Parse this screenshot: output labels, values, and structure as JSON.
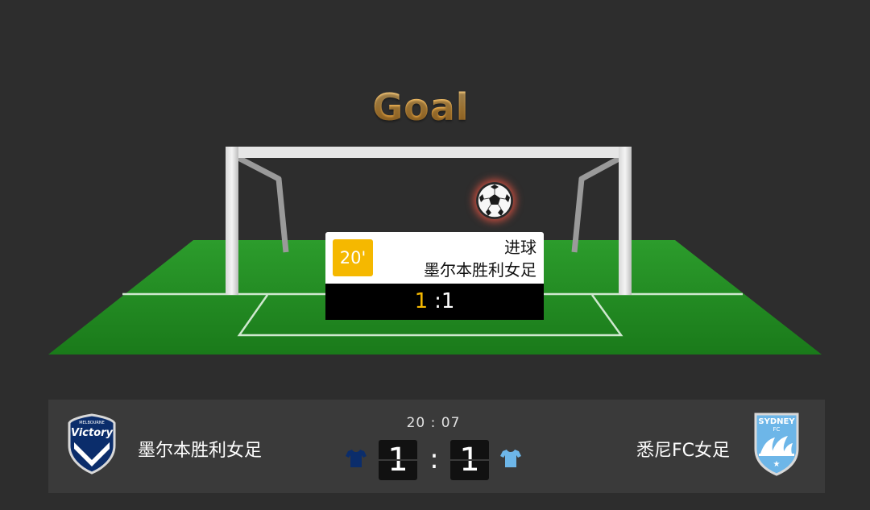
{
  "animation": {
    "title": "Goal",
    "event": {
      "minute": "20'",
      "type": "进球",
      "team": "墨尔本胜利女足",
      "score_home": "1",
      "score_away": "1"
    }
  },
  "scoreboard": {
    "home": {
      "name": "墨尔本胜利女足",
      "logo_text": "Victory",
      "logo_subtext": "MELBOURNE",
      "kit_color": "#0b2d6b"
    },
    "away": {
      "name": "悉尼FC女足",
      "logo_text": "SYDNEY",
      "logo_subtext": "FC",
      "kit_color": "#6db6e8"
    },
    "time": "20 : 07",
    "home_score": "1",
    "separator": ":",
    "away_score": "1"
  },
  "colors": {
    "background": "#2d2d2d",
    "scorebar": "#3a3a3a",
    "accent": "#f5b800",
    "pitch": "#1e8a1e"
  }
}
